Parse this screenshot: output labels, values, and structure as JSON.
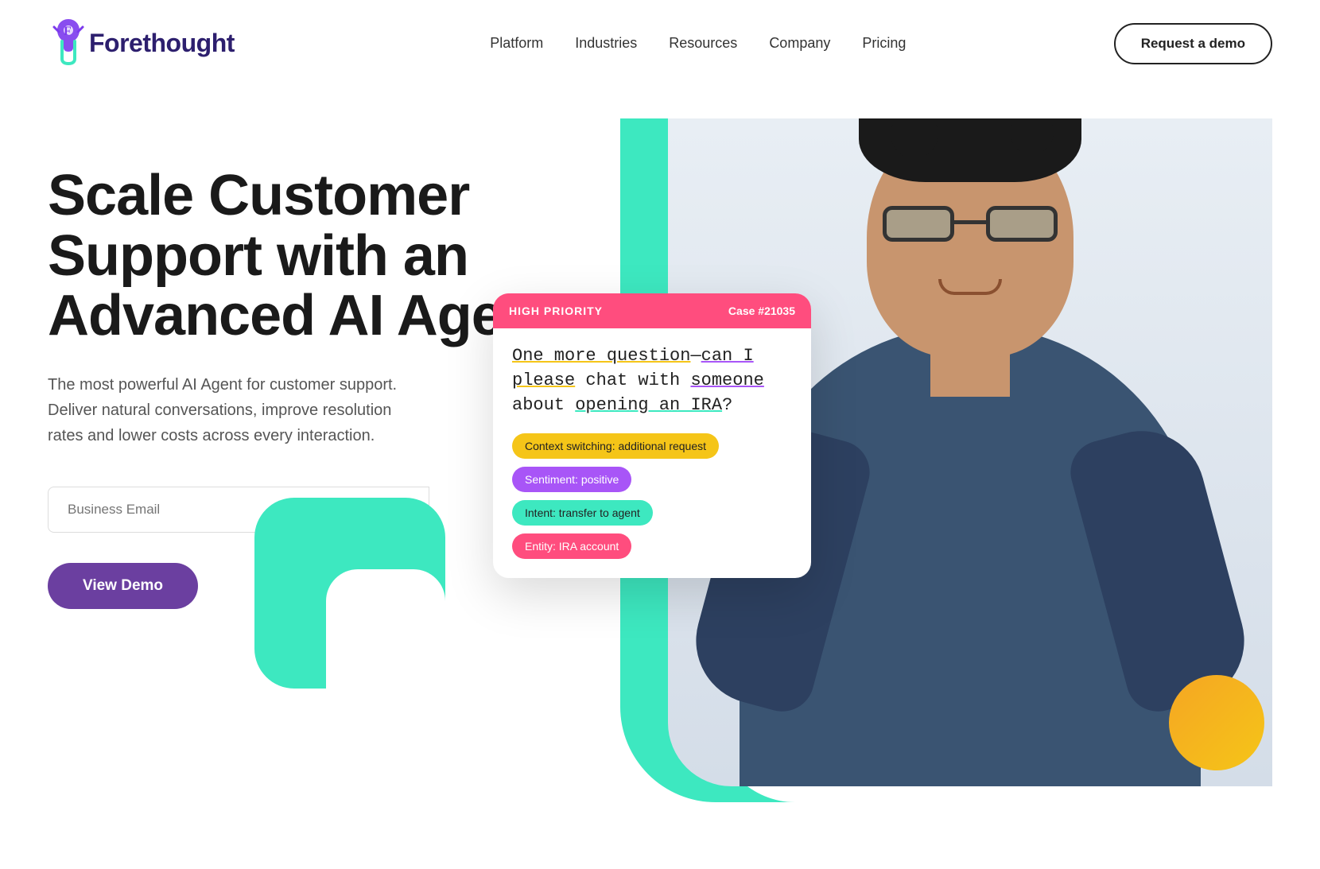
{
  "nav": {
    "brand": "Forethought",
    "links": [
      "Platform",
      "Industries",
      "Resources",
      "Company",
      "Pricing"
    ],
    "cta": "Request a demo"
  },
  "hero": {
    "title": "Scale Customer Support with an Advanced AI Agent",
    "subtitle": "The most powerful AI Agent for customer support. Deliver natural conversations, improve resolution rates and lower costs across every interaction.",
    "email_placeholder": "Business Email",
    "cta_button": "View Demo"
  },
  "chat_card": {
    "priority_label": "HIGH PRIORITY",
    "case_label": "Case #21035",
    "message_part1": "One more question—can I",
    "message_part2": "please chat with someone",
    "message_part3": "about opening an IRA?",
    "tags": [
      {
        "label": "Context switching: additional request",
        "style": "yellow"
      },
      {
        "label": "Sentiment: positive",
        "style": "purple"
      },
      {
        "label": "Intent: transfer to agent",
        "style": "teal"
      },
      {
        "label": "Entity: IRA account",
        "style": "pink"
      }
    ]
  },
  "colors": {
    "brand_purple": "#6b3fa0",
    "teal_accent": "#3de8c0",
    "pink_accent": "#ff4d7e",
    "orange_accent": "#f5a623"
  }
}
